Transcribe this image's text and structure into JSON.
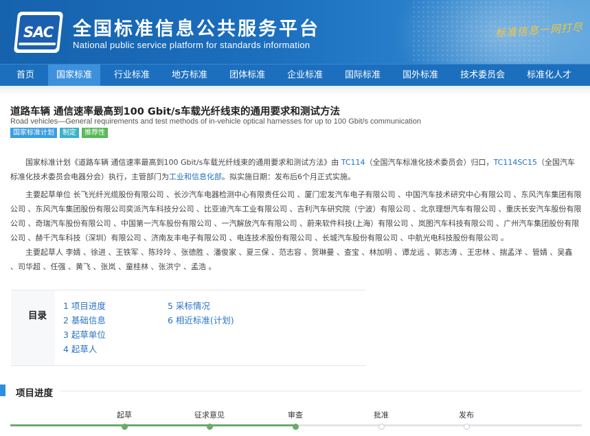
{
  "header": {
    "logo_text": "SAC",
    "title": "全国标准信息公共服务平台",
    "subtitle": "National public service platform  for standards information",
    "slogan": "标准信息一网打尽"
  },
  "nav": {
    "items": [
      {
        "label": "首页",
        "active": false
      },
      {
        "label": "国家标准",
        "active": true
      },
      {
        "label": "行业标准",
        "active": false
      },
      {
        "label": "地方标准",
        "active": false
      },
      {
        "label": "团体标准",
        "active": false
      },
      {
        "label": "企业标准",
        "active": false
      },
      {
        "label": "国际标准",
        "active": false
      },
      {
        "label": "国外标准",
        "active": false
      },
      {
        "label": "技术委员会",
        "active": false
      },
      {
        "label": "标准化人才",
        "active": false
      }
    ]
  },
  "standard": {
    "title": "道路车辆 通信速率最高到100 Gbit/s车载光纤线束的通用要求和测试方法",
    "title_en": "Road vehicles—General requirements and test methods of in-vehicle optical harnesses for up to 100 Gbit/s communication",
    "tags": [
      "国家标准计划",
      "制定",
      "推荐性"
    ]
  },
  "content": {
    "p1_a": "国家标准计划《道路车辆 通信速率最高到100 Gbit/s车载光纤线束的通用要求和测试方法》由 ",
    "p1_link1": "TC114",
    "p1_b": "（全国汽车标准化技术委员会）归口，",
    "p1_link2": "TC114SC15",
    "p1_c": "（全国汽车标准化技术委员会电器分会）执行，主管部门为",
    "p1_link3": "工业和信息化部",
    "p1_d": "。拟实施日期：发布后6个月正式实施。",
    "p2": "主要起草单位 长飞光纤光缆股份有限公司 、长沙汽车电器检测中心有限责任公司 、厦门宏发汽车电子有限公司 、中国汽车技术研究中心有限公司 、东风汽车集团有限公司 、东风汽车集团股份有限公司奕派汽车科技分公司 、比亚迪汽车工业有限公司 、吉利汽车研究院（宁波）有限公司 、北京理想汽车有限公司 、重庆长安汽车股份有限公司 、奇瑞汽车股份有限公司 、中国第一汽车股份有限公司 、一汽解放汽车有限公司 、蔚来软件科技(上海）有限公司 、岚图汽车科技有限公司 、广州汽车集团股份有限公司 、赫千汽车科技（深圳）有限公司 、济南友丰电子有限公司 、电连技术股份有限公司 、长城汽车股份有限公司 、中航光电科技股份有限公司 。",
    "p3": "主要起草人 李婧 、徐进 、王铁军 、陈玲玲 、张德胜 、潘俊家 、夏三保 、范志容 、贺琳曼 、查宝 、林加明 、谭龙远 、郭志涛 、王忠林 、揣孟洋 、管婧 、吴鑫 、司华超 、任强 、黄飞 、张岚 、童桂林 、张洪宁 、孟浩 。"
  },
  "toc": {
    "title": "目录",
    "col1": [
      "1  项目进度",
      "2  基础信息",
      "3  起草单位",
      "4  起草人"
    ],
    "col2": [
      "5  采标情况",
      "6  相近标准(计划)"
    ]
  },
  "progress": {
    "title": "项目进度",
    "completed_steps": 3,
    "steps": [
      "起草",
      "征求意见",
      "审查",
      "批准",
      "发布"
    ],
    "colors": {
      "done": "#6aab6b",
      "pending": "#e2e5e9"
    }
  }
}
